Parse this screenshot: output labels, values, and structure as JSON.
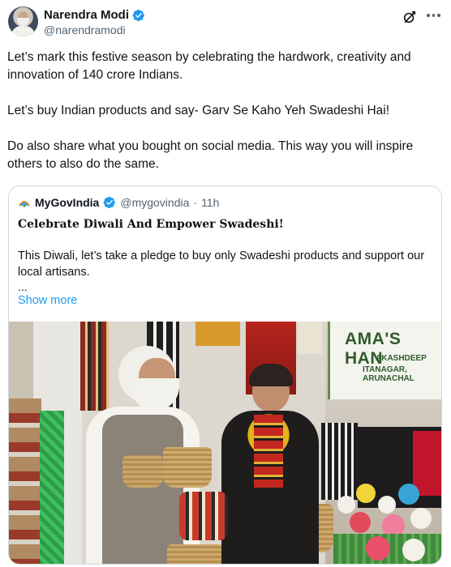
{
  "author": {
    "name": "Narendra Modi",
    "handle": "@narendramodi"
  },
  "tweet": {
    "paragraphs": [
      "Let’s mark this festive season by celebrating the hardwork, creativity and innovation of 140 crore Indians.",
      "Let’s buy Indian products and say- Garv Se Kaho Yeh Swadeshi Hai!",
      "Do also share what you bought on social media. This way you will inspire others to also do the same."
    ]
  },
  "quote": {
    "name": "MyGovIndia",
    "handle": "@mygovindia",
    "separator": "·",
    "time": "11h",
    "title": "Celebrate Diwali And Empower Swadeshi!",
    "body": "This Diwali, let’s take a pledge to buy only Swadeshi products and support our local artisans.",
    "ellipsis": "...",
    "show_more": "Show more",
    "photo_sign": {
      "title": "AMA'S HAN",
      "line1": "AKASHDEEP",
      "line2": "ITANAGAR, ARUNACHAL"
    }
  },
  "colors": {
    "link": "#1d9bf0",
    "verified": "#1d9bf0",
    "secondary_text": "#536471",
    "border": "#cfd9de"
  },
  "icons": [
    "verified-badge-icon",
    "grok-icon",
    "more-icon",
    "mygov-logo-icon"
  ]
}
